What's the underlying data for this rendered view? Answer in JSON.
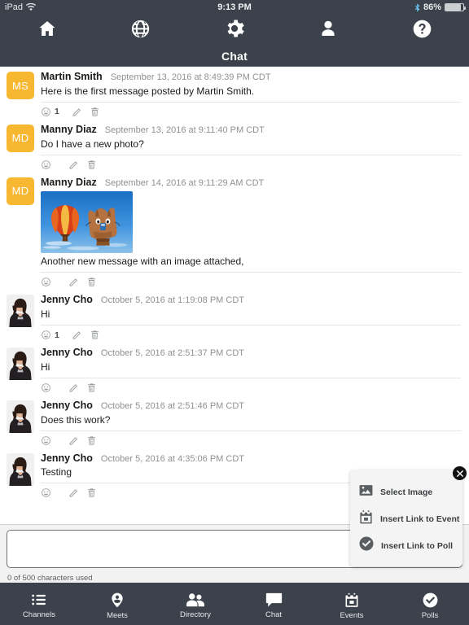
{
  "statusbar": {
    "device": "iPad",
    "wifi_icon": "wifi-icon",
    "time": "9:13 PM",
    "bluetooth_icon": "bluetooth-icon",
    "battery_percent": "86%",
    "battery_level": 86
  },
  "topnav": {
    "items": [
      {
        "name": "home",
        "icon": "home-icon"
      },
      {
        "name": "globe",
        "icon": "globe-icon"
      },
      {
        "name": "settings",
        "icon": "gear-icon"
      },
      {
        "name": "profile",
        "icon": "person-icon"
      },
      {
        "name": "help",
        "icon": "question-circle-icon"
      }
    ]
  },
  "header": {
    "title": "Chat"
  },
  "colors": {
    "chrome": "#3b424b",
    "avatar_initials_bg": "#f7b731",
    "text_primary": "#1b1b1b",
    "text_muted": "#8e9194",
    "icon_muted": "#9a9da0",
    "composer_bg": "#f2f2f2",
    "popup_bg": "#f4f4f4"
  },
  "messages": [
    {
      "author": "Martin Smith",
      "timestamp": "September 13, 2016 at 8:49:39 PM CDT",
      "text": "Here is the first message posted by Martin Smith.",
      "avatar_type": "initials",
      "avatar_initials": "MS",
      "image": null,
      "reaction_count": "1",
      "actions": [
        "reaction-icon",
        "edit-icon",
        "delete-icon"
      ]
    },
    {
      "author": "Manny Diaz",
      "timestamp": "September 13, 2016 at 9:11:40 PM CDT",
      "text": "Do I have a new photo?",
      "avatar_type": "initials",
      "avatar_initials": "MD",
      "image": null,
      "reaction_count": "",
      "actions": [
        "reaction-icon",
        "edit-icon",
        "delete-icon"
      ]
    },
    {
      "author": "Manny Diaz",
      "timestamp": "September 14, 2016 at 9:11:29 AM CDT",
      "text": "Another new message with an image attached,",
      "avatar_type": "initials",
      "avatar_initials": "MD",
      "image": "hot-air-balloons-photo",
      "reaction_count": "",
      "actions": [
        "reaction-icon",
        "edit-icon",
        "delete-icon"
      ]
    },
    {
      "author": "Jenny Cho",
      "timestamp": "October 5, 2016 at 1:19:08 PM CDT",
      "text": "Hi",
      "avatar_type": "photo",
      "avatar_initials": "",
      "image": null,
      "reaction_count": "1",
      "actions": [
        "reaction-icon",
        "edit-icon",
        "delete-icon"
      ]
    },
    {
      "author": "Jenny Cho",
      "timestamp": "October 5, 2016 at 2:51:37 PM CDT",
      "text": "Hi",
      "avatar_type": "photo",
      "avatar_initials": "",
      "image": null,
      "reaction_count": "",
      "actions": [
        "reaction-icon",
        "edit-icon",
        "delete-icon"
      ]
    },
    {
      "author": "Jenny Cho",
      "timestamp": "October 5, 2016 at 2:51:46 PM CDT",
      "text": "Does this work?",
      "avatar_type": "photo",
      "avatar_initials": "",
      "image": null,
      "reaction_count": "",
      "actions": [
        "reaction-icon",
        "edit-icon",
        "delete-icon"
      ]
    },
    {
      "author": "Jenny Cho",
      "timestamp": "October 5, 2016 at 4:35:06 PM CDT",
      "text": "Testing",
      "avatar_type": "photo",
      "avatar_initials": "",
      "image": null,
      "reaction_count": "",
      "actions": [
        "reaction-icon",
        "edit-icon",
        "delete-icon"
      ]
    }
  ],
  "composer": {
    "value": "",
    "placeholder": "",
    "char_counter": "0 of 500 characters used"
  },
  "attachment_popup": {
    "visible": true,
    "close_icon": "close-circle-icon",
    "items": [
      {
        "label": "Select Image",
        "icon": "image-icon"
      },
      {
        "label": "Insert Link to Event",
        "icon": "calendar-icon"
      },
      {
        "label": "Insert Link to Poll",
        "icon": "check-circle-icon"
      }
    ]
  },
  "tabbar": {
    "active": "Chat",
    "items": [
      {
        "label": "Channels",
        "icon": "list-icon"
      },
      {
        "label": "Meets",
        "icon": "map-pin-person-icon"
      },
      {
        "label": "Directory",
        "icon": "people-icon"
      },
      {
        "label": "Chat",
        "icon": "chat-bubble-icon"
      },
      {
        "label": "Events",
        "icon": "calendar-icon"
      },
      {
        "label": "Polls",
        "icon": "check-circle-icon"
      }
    ]
  }
}
